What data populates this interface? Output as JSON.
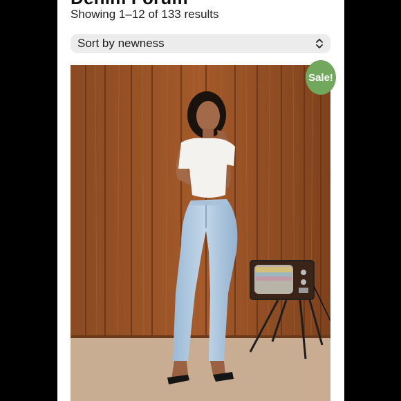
{
  "shop": {
    "title": "Denim Forum",
    "result_count": "Showing 1–12 of 133 results"
  },
  "sort": {
    "selected": "Sort by newness",
    "icon": "updown-chevron-icon"
  },
  "product": {
    "sale_badge": "Sale!",
    "badge_color": "#72a85e"
  }
}
